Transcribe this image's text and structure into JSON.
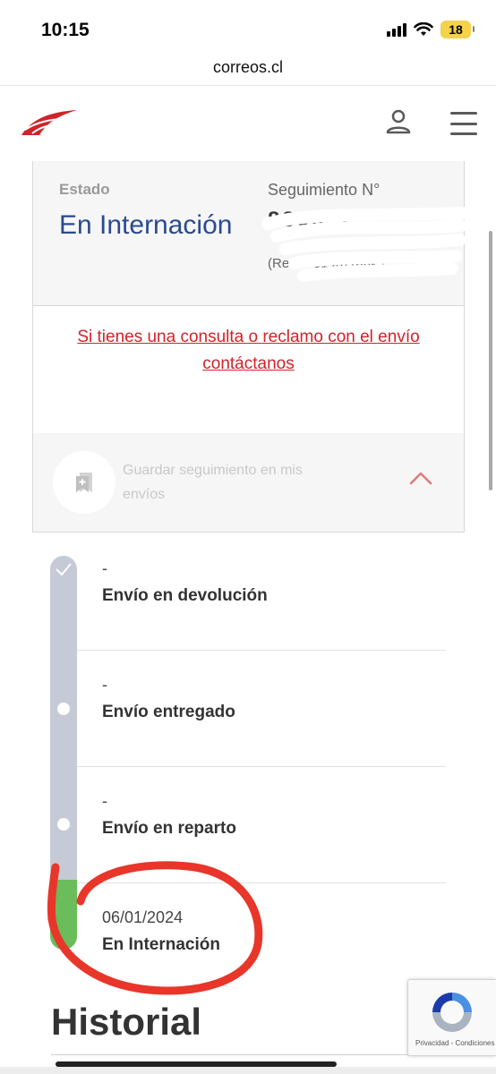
{
  "status_bar": {
    "time": "10:15",
    "battery": "18"
  },
  "browser": {
    "url": "correos.cl"
  },
  "colors": {
    "brand_red": "#d0232a",
    "estado_blue": "#2b4a8f",
    "timeline_gray": "#c5cad6",
    "timeline_green": "#6abd5a"
  },
  "card": {
    "estado_label": "Estado",
    "estado_value": "En Internación",
    "seguimiento_label": "Seguimiento N°",
    "seguimiento_value": "8800 5",
    "ref_value": "(Ref: S 0140) (ahk f",
    "contact_link": "Si tienes una consulta o reclamo con el envío contáctanos",
    "save_tracking": "Guardar seguimiento en mis envíos"
  },
  "timeline": {
    "items": [
      {
        "date": "-",
        "status": "Envío en devolución"
      },
      {
        "date": "-",
        "status": "Envío entregado"
      },
      {
        "date": "-",
        "status": "Envío en reparto"
      },
      {
        "date": "06/01/2024",
        "status": "En Internación"
      }
    ]
  },
  "historial_title": "Historial",
  "recaptcha": {
    "privacy": "Privacidad",
    "separator": " - ",
    "terms": "Condiciones"
  },
  "icons": {
    "logo": "correos-logo-icon",
    "user": "user-icon",
    "menu": "hamburger-menu-icon",
    "save": "bookmark-add-icon",
    "collapse": "chevron-up-icon",
    "check": "check-icon",
    "recaptcha": "recaptcha-icon"
  }
}
